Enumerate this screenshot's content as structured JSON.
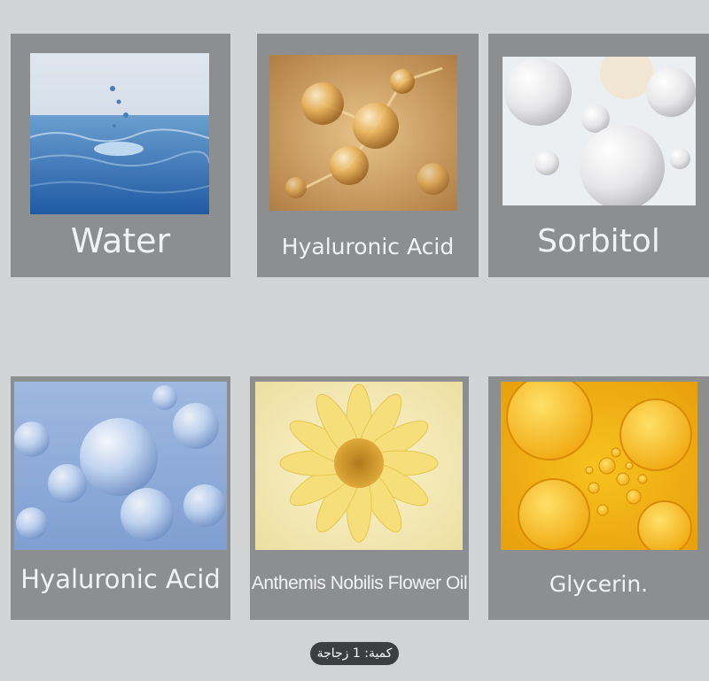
{
  "cards": [
    {
      "label": "Water",
      "image": "water-splash-photo"
    },
    {
      "label": "Hyaluronic Acid",
      "image": "golden-molecule-photo"
    },
    {
      "label": "Sorbitol",
      "image": "white-spheres-photo"
    },
    {
      "label": "Hyaluronic Acid",
      "image": "blue-bubbles-photo"
    },
    {
      "label": "Anthemis Nobilis Flower Oil",
      "image": "yellow-chamomile-flower-photo"
    },
    {
      "label": "Glycerin.",
      "image": "yellow-oil-droplets-photo"
    }
  ],
  "quantity_badge": "كمية: 1 زجاجة",
  "colors": {
    "background": "#d2d3d5",
    "card": "#8d8e90",
    "label_text": "#f2f2f2",
    "badge": "#3d3e40"
  }
}
